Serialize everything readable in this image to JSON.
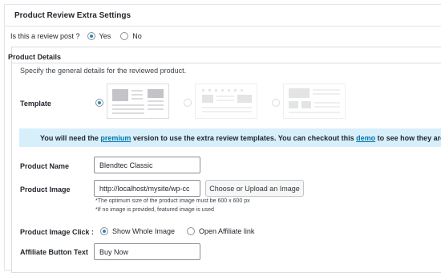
{
  "metabox": {
    "title": "Product Review Extra Settings"
  },
  "review_question": {
    "label": "Is this a review post ?",
    "yes": "Yes",
    "no": "No",
    "selected": "Yes"
  },
  "details": {
    "title": "Product Details",
    "description": "Specify the general details for the reviewed product."
  },
  "template": {
    "label": "Template",
    "selected_index": 0
  },
  "notice": {
    "part1": "You will need the ",
    "premium_link": "premium",
    "part2": " version to use the extra review templates. You can checkout this ",
    "demo_link": "demo",
    "part3": " to see how they are l"
  },
  "product_name": {
    "label": "Product Name",
    "value": "Blendtec Classic"
  },
  "product_image": {
    "label": "Product Image",
    "value": "http://localhost/mysite/wp-cc",
    "button": "Choose or Upload an Image",
    "hint1": "*The optimum size of the product image must be 600 x 600 px",
    "hint2": "*If no image is provided, featured image is used"
  },
  "image_click": {
    "label": "Product Image Click :",
    "option1": "Show Whole Image",
    "option2": "Open Affiliate link",
    "selected": "Show Whole Image"
  },
  "affiliate": {
    "label": "Affiliate Button Text",
    "value": "Buy Now"
  },
  "colors": {
    "accent": "#1e8cbe",
    "link": "#0073aa",
    "notice_bg": "#d7effb"
  }
}
